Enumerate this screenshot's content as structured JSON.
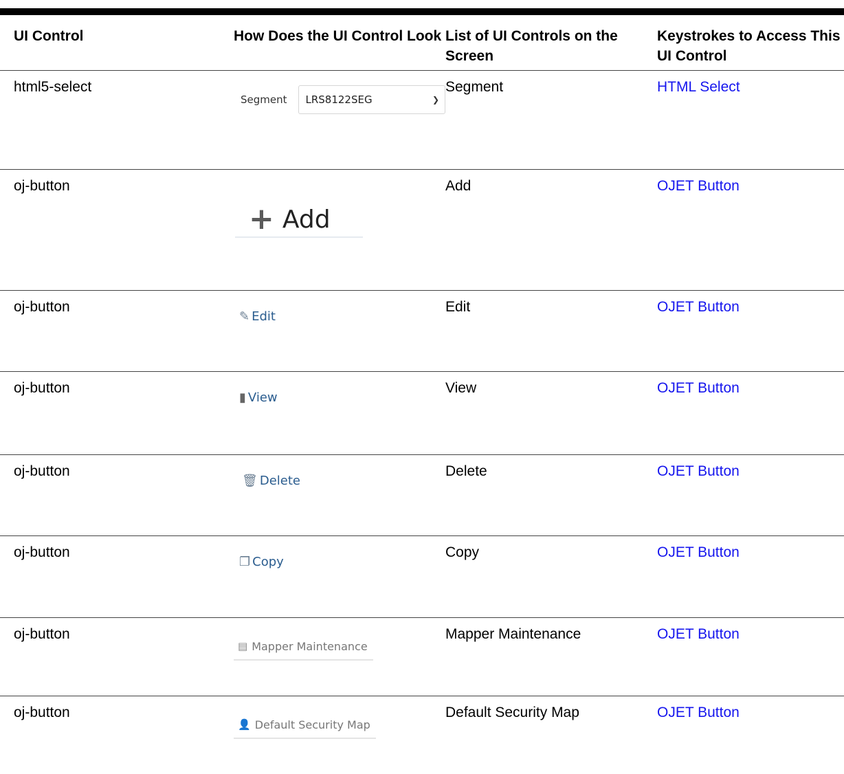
{
  "headers": [
    "UI Control",
    "How Does the UI Control Look",
    "List of UI Controls on the Screen",
    "Keystrokes to Access This UI Control"
  ],
  "rows": [
    {
      "control": "html5-select",
      "screen_item": "Segment",
      "keystroke_link": "HTML Select",
      "look": {
        "label": "Segment",
        "value": "LRS8122SEG",
        "icon": "chevron-down-icon"
      }
    },
    {
      "control": "oj-button",
      "screen_item": "Add",
      "keystroke_link": "OJET Button",
      "look": {
        "label": "Add",
        "icon": "plus-icon"
      }
    },
    {
      "control": "oj-button",
      "screen_item": "Edit",
      "keystroke_link": "OJET Button",
      "look": {
        "label": "Edit",
        "icon": "edit-icon"
      }
    },
    {
      "control": "oj-button",
      "screen_item": "View",
      "keystroke_link": "OJET Button",
      "look": {
        "label": "View",
        "icon": "view-icon"
      }
    },
    {
      "control": "oj-button",
      "screen_item": "Delete",
      "keystroke_link": "OJET Button",
      "look": {
        "label": "Delete",
        "icon": "trash-icon"
      }
    },
    {
      "control": "oj-button",
      "screen_item": "Copy",
      "keystroke_link": "OJET Button",
      "look": {
        "label": "Copy",
        "icon": "copy-icon"
      }
    },
    {
      "control": "oj-button",
      "screen_item": "Mapper Maintenance",
      "keystroke_link": "OJET Button",
      "look": {
        "label": "Mapper Maintenance",
        "icon": "table-icon"
      }
    },
    {
      "control": "oj-button",
      "screen_item": "Default Security Map",
      "keystroke_link": "OJET Button",
      "look": {
        "label": "Default Security Map",
        "icon": "user-icon"
      }
    }
  ],
  "colors": {
    "link": "#1616ee",
    "rule": "#444444",
    "edit_button_text": "#2b5d8f"
  }
}
